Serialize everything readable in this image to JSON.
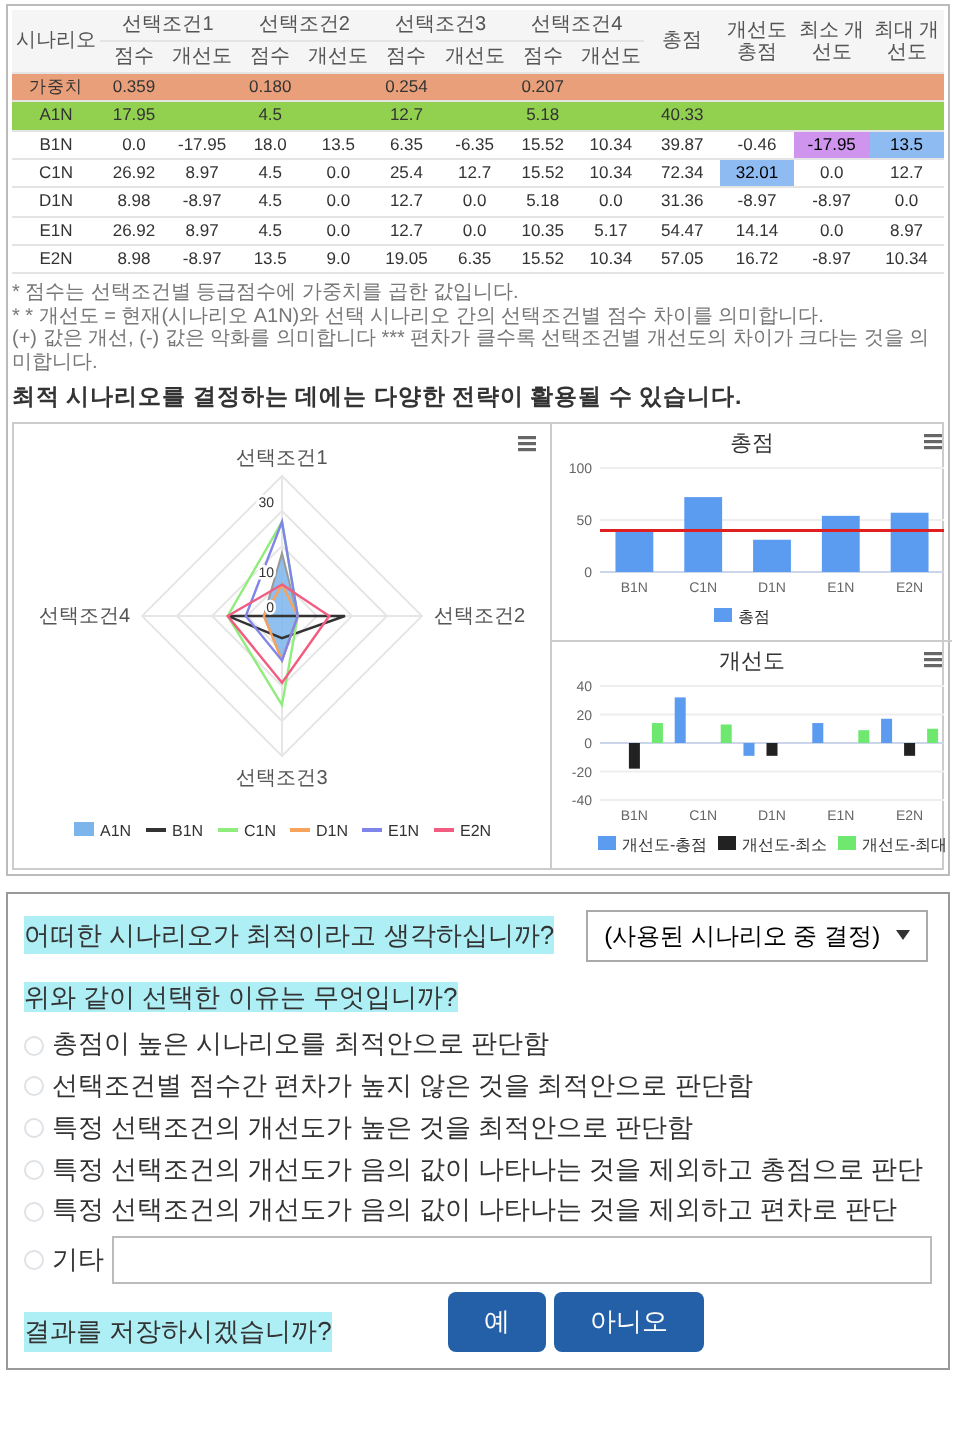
{
  "table": {
    "columns": [
      {
        "label": "시나리오"
      },
      {
        "label": "선택조건1",
        "subcolumns": [
          "점수",
          "개선도"
        ]
      },
      {
        "label": "선택조건2",
        "subcolumns": [
          "점수",
          "개선도"
        ]
      },
      {
        "label": "선택조건3",
        "subcolumns": [
          "점수",
          "개선도"
        ]
      },
      {
        "label": "선택조건4",
        "subcolumns": [
          "점수",
          "개선도"
        ]
      },
      {
        "label": "총점"
      },
      {
        "label": "개선도 총점"
      },
      {
        "label": "최소 개선도"
      },
      {
        "label": "최대 개선도"
      }
    ],
    "rows": [
      {
        "label": "가중치",
        "kind": "weight",
        "conditions": [
          {
            "score": "0.359"
          },
          {
            "score": "0.180"
          },
          {
            "score": "0.254"
          },
          {
            "score": "0.207"
          }
        ]
      },
      {
        "label": "A1N",
        "kind": "baseline",
        "conditions": [
          {
            "score": "17.95"
          },
          {
            "score": "4.5"
          },
          {
            "score": "12.7"
          },
          {
            "score": "5.18"
          }
        ],
        "total": "40.33"
      },
      {
        "label": "B1N",
        "kind": "scenario",
        "conditions": [
          {
            "score": "0.0",
            "improvement": "-17.95"
          },
          {
            "score": "18.0",
            "improvement": "13.5"
          },
          {
            "score": "6.35",
            "improvement": "-6.35"
          },
          {
            "score": "15.52",
            "improvement": "10.34"
          }
        ],
        "total": "39.87",
        "improvement_total": {
          "text": "-0.46",
          "highlighted": false
        },
        "min_improvement": {
          "text": "-17.95",
          "highlighted": true
        },
        "max_improvement": {
          "text": "13.5",
          "highlighted": true
        }
      },
      {
        "label": "C1N",
        "kind": "scenario",
        "conditions": [
          {
            "score": "26.92",
            "improvement": "8.97"
          },
          {
            "score": "4.5",
            "improvement": "0.0"
          },
          {
            "score": "25.4",
            "improvement": "12.7"
          },
          {
            "score": "15.52",
            "improvement": "10.34"
          }
        ],
        "total": "72.34",
        "improvement_total": {
          "text": "32.01",
          "highlighted": true
        },
        "min_improvement": {
          "text": "0.0",
          "highlighted": false
        },
        "max_improvement": {
          "text": "12.7",
          "highlighted": false
        }
      },
      {
        "label": "D1N",
        "kind": "scenario",
        "conditions": [
          {
            "score": "8.98",
            "improvement": "-8.97"
          },
          {
            "score": "4.5",
            "improvement": "0.0"
          },
          {
            "score": "12.7",
            "improvement": "0.0"
          },
          {
            "score": "5.18",
            "improvement": "0.0"
          }
        ],
        "total": "31.36",
        "improvement_total": {
          "text": "-8.97",
          "highlighted": false
        },
        "min_improvement": {
          "text": "-8.97",
          "highlighted": false
        },
        "max_improvement": {
          "text": "0.0",
          "highlighted": false
        }
      },
      {
        "label": "E1N",
        "kind": "scenario",
        "conditions": [
          {
            "score": "26.92",
            "improvement": "8.97"
          },
          {
            "score": "4.5",
            "improvement": "0.0"
          },
          {
            "score": "12.7",
            "improvement": "0.0"
          },
          {
            "score": "10.35",
            "improvement": "5.17"
          }
        ],
        "total": "54.47",
        "improvement_total": {
          "text": "14.14",
          "highlighted": false
        },
        "min_improvement": {
          "text": "0.0",
          "highlighted": false
        },
        "max_improvement": {
          "text": "8.97",
          "highlighted": false
        }
      },
      {
        "label": "E2N",
        "kind": "scenario",
        "conditions": [
          {
            "score": "8.98",
            "improvement": "-8.97"
          },
          {
            "score": "13.5",
            "improvement": "9.0"
          },
          {
            "score": "19.05",
            "improvement": "6.35"
          },
          {
            "score": "15.52",
            "improvement": "10.34"
          }
        ],
        "total": "57.05",
        "improvement_total": {
          "text": "16.72",
          "highlighted": false
        },
        "min_improvement": {
          "text": "-8.97",
          "highlighted": false
        },
        "max_improvement": {
          "text": "10.34",
          "highlighted": false
        }
      }
    ]
  },
  "footnotes": [
    "* 점수는 선택조건별 등급점수에 가중치를 곱한 값입니다.",
    "* * 개선도 = 현재(시나리오 A1N)와 선택 시나리오 간의 선택조건별 점수 차이를 의미합니다.",
    "(+) 값은 개선, (-) 값은 악화를 의미합니다 *** 편차가 클수록 선택조건별 개선도의 차이가 크다는 것을 의미합니다."
  ],
  "charts_heading": "최적 시나리오를 결정하는 데에는 다양한 전략이 활용될 수 있습니다.",
  "radar": {
    "axes": [
      "선택조건1",
      "선택조건2",
      "선택조건3",
      "선택조건4"
    ],
    "ticks": [
      "30",
      "10",
      "0"
    ],
    "legend": [
      {
        "name": "A1N",
        "kind": "area",
        "color": "#7cb5ec"
      },
      {
        "name": "B1N",
        "kind": "line",
        "color": "#333333"
      },
      {
        "name": "C1N",
        "kind": "line",
        "color": "#90ed7d"
      },
      {
        "name": "D1N",
        "kind": "line",
        "color": "#f7a35c"
      },
      {
        "name": "E1N",
        "kind": "line",
        "color": "#8085e9"
      },
      {
        "name": "E2N",
        "kind": "line",
        "color": "#f15c80"
      }
    ]
  },
  "total_chart": {
    "chart_data": {
      "type": "bar",
      "title": "총점",
      "categories": [
        "B1N",
        "C1N",
        "D1N",
        "E1N",
        "E2N"
      ],
      "ylim": [
        0,
        100
      ],
      "yticks": [
        0,
        50,
        100
      ],
      "series": [
        {
          "name": "총점",
          "color": "#5b9bf0",
          "values": [
            40,
            72,
            31,
            54,
            57
          ]
        }
      ],
      "legend": "bottom",
      "ref_lines": [
        {
          "axis": "y",
          "value": 40,
          "color": "#e02020"
        }
      ]
    }
  },
  "improvement_chart": {
    "chart_data": {
      "type": "bar",
      "title": "개선도",
      "categories": [
        "B1N",
        "C1N",
        "D1N",
        "E1N",
        "E2N"
      ],
      "ylim": [
        -40,
        40
      ],
      "yticks": [
        -40,
        -20,
        0,
        20,
        40
      ],
      "legend": "bottom",
      "series": [
        {
          "name": "개선도-총점",
          "color": "#5b9bf0",
          "values": [
            0,
            32,
            -9,
            14,
            17
          ]
        },
        {
          "name": "개선도-최소",
          "color": "#222222",
          "values": [
            -18,
            0,
            -9,
            0,
            -9
          ]
        },
        {
          "name": "개선도-최대",
          "color": "#6ee86e",
          "values": [
            14,
            13,
            0,
            9,
            10
          ]
        }
      ]
    }
  },
  "form": {
    "question_1": "어떠한 시나리오가 최적이라고 생각하십니까?",
    "dropdown": {
      "value": "(사용된 시나리오 중 결정)"
    },
    "question_2": "위와 같이 선택한 이유는 무엇입니까?",
    "options": [
      {
        "kind": "choice",
        "label": "총점이 높은 시나리오를 최적안으로 판단함",
        "selected": false
      },
      {
        "kind": "choice",
        "label": "선택조건별 점수간 편차가 높지 않은 것을 최적안으로 판단함",
        "selected": false
      },
      {
        "kind": "choice",
        "label": "특정 선택조건의 개선도가 높은 것을 최적안으로 판단함",
        "selected": false
      },
      {
        "kind": "choice",
        "label": "특정 선택조건의 개선도가 음의 값이 나타나는 것을 제외하고 총점으로 판단",
        "selected": false
      },
      {
        "kind": "choice",
        "label": "특정 선택조건의 개선도가 음의 값이 나타나는 것을 제외하고 편차로 판단",
        "selected": false
      },
      {
        "kind": "other",
        "label": "기타",
        "selected": false
      }
    ],
    "save_question": "결과를 저장하시겠습니까?",
    "buttons": [
      "예",
      "아니오"
    ]
  }
}
